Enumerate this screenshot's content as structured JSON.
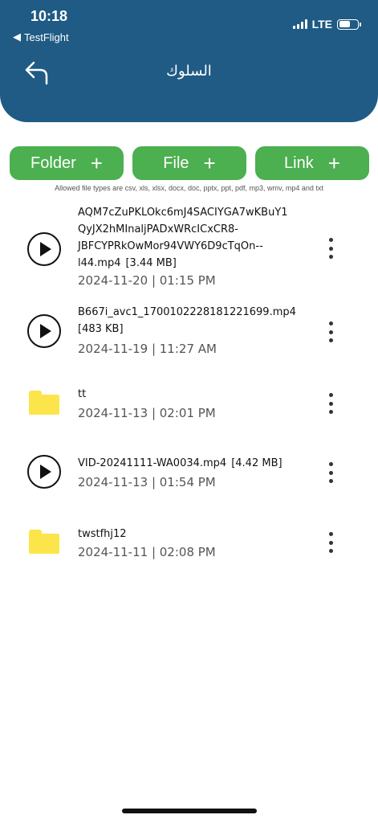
{
  "status_bar": {
    "time": "10:18",
    "back_app": "TestFlight",
    "network": "LTE"
  },
  "header": {
    "title": "السلوك",
    "back_icon": "return-arrow-icon",
    "background_color": "#1f5b84"
  },
  "actions": [
    {
      "label": "Folder",
      "icon": "plus-icon"
    },
    {
      "label": "File",
      "icon": "plus-icon"
    },
    {
      "label": "Link",
      "icon": "plus-icon"
    }
  ],
  "accent_color": "#4caf50",
  "allowed_types_text": "Allowed file types are csv, xls, xlsx, docx, doc, pptx, ppt, pdf, mp3, wmv, mp4 and txt",
  "items": [
    {
      "type": "video",
      "name_lines": [
        "AQM7cZuPKLOkc6mJ4SACIYGA7wKBuY1",
        "QyJX2hMInaljPADxWRcICxCR8-",
        "JBFCYPRkOwMor94VWY6D9cTqOn--",
        "l44.mp4"
      ],
      "size": "[3.44 MB]",
      "date": "2024-11-20 | 01:15 PM"
    },
    {
      "type": "video",
      "name_lines": [
        "B667i_avc1_1700102228181221699.mp4"
      ],
      "size": "[483 KB]",
      "date": "2024-11-19 | 11:27 AM"
    },
    {
      "type": "folder",
      "name_lines": [
        "tt"
      ],
      "size": "",
      "date": "2024-11-13 | 02:01 PM"
    },
    {
      "type": "video",
      "name_lines": [
        "VID-20241111-WA0034.mp4"
      ],
      "size": "[4.42 MB]",
      "date": "2024-11-13 | 01:54 PM"
    },
    {
      "type": "folder",
      "name_lines": [
        "twstfhj12"
      ],
      "size": "",
      "date": "2024-11-11 | 02:08 PM"
    }
  ]
}
